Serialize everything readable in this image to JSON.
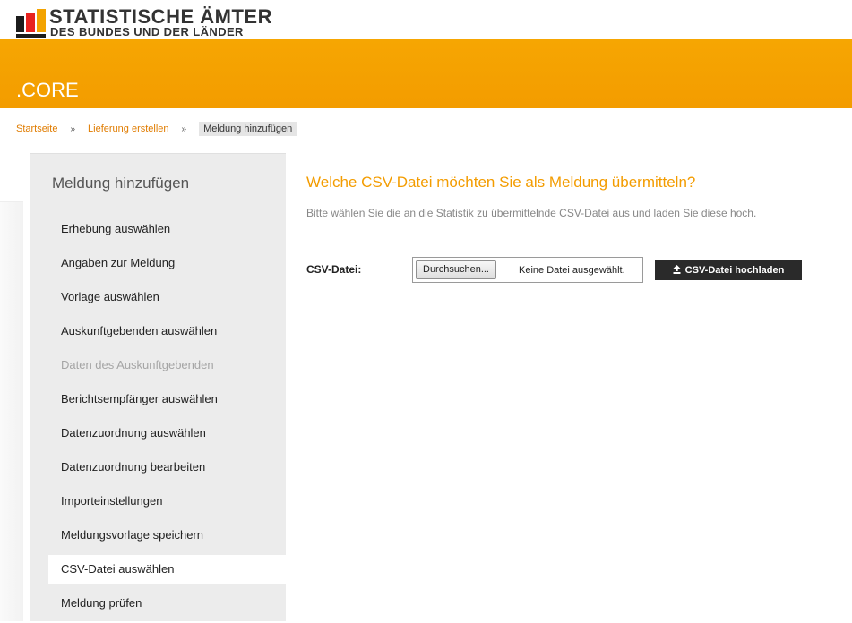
{
  "header": {
    "logo_line1": "STATISTISCHE ÄMTER",
    "logo_line2": "DES BUNDES UND DER LÄNDER",
    "app_title": ".CORE",
    "accent_color": "#f39c00"
  },
  "breadcrumb": {
    "items": [
      "Startseite",
      "Lieferung erstellen",
      "Meldung hinzufügen"
    ],
    "separator": "»"
  },
  "sidebar": {
    "title": "Meldung hinzufügen",
    "items": [
      {
        "label": "Erhebung auswählen",
        "state": "enabled"
      },
      {
        "label": "Angaben zur Meldung",
        "state": "enabled"
      },
      {
        "label": "Vorlage auswählen",
        "state": "enabled"
      },
      {
        "label": "Auskunftgebenden auswählen",
        "state": "enabled"
      },
      {
        "label": "Daten des Auskunftgebenden",
        "state": "disabled"
      },
      {
        "label": "Berichtsempfänger auswählen",
        "state": "enabled"
      },
      {
        "label": "Datenzuordnung auswählen",
        "state": "enabled"
      },
      {
        "label": "Datenzuordnung bearbeiten",
        "state": "enabled"
      },
      {
        "label": "Importeinstellungen",
        "state": "enabled"
      },
      {
        "label": "Meldungsvorlage speichern",
        "state": "enabled"
      },
      {
        "label": "CSV-Datei auswählen",
        "state": "active"
      },
      {
        "label": "Meldung prüfen",
        "state": "enabled"
      }
    ]
  },
  "main": {
    "title": "Welche CSV-Datei möchten Sie als Meldung übermitteln?",
    "description": "Bitte wählen Sie die an die Statistik zu übermittelnde CSV-Datei aus und laden Sie diese hoch.",
    "csv_label": "CSV-Datei:",
    "browse_label": "Durchsuchen...",
    "no_file_text": "Keine Datei ausgewählt.",
    "upload_label": "CSV-Datei hochladen",
    "upload_icon": "upload-icon"
  }
}
